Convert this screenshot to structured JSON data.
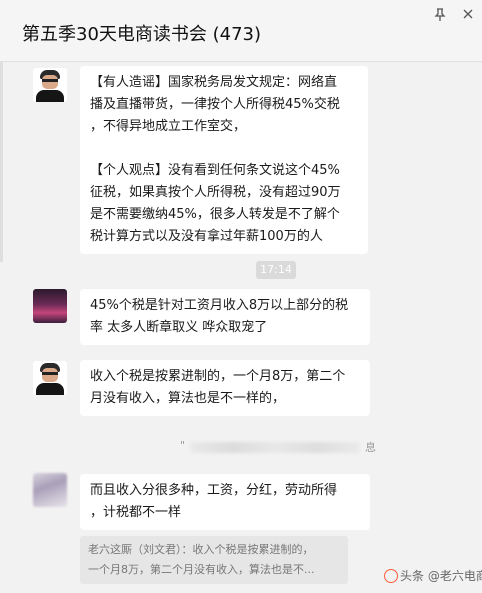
{
  "window": {
    "title": "第五季30天电商读书会 (473)",
    "pin_icon": "pin-icon",
    "close_icon": "close-icon"
  },
  "messages": [
    {
      "avatar": "man-with-glasses",
      "lines": [
        "【有人造谣】国家税务局发文规定：网络直",
        "播及直播带货，一律按个人所得税45%交税",
        "，不得异地成立工作室交，",
        "",
        "【个人观点】没有看到任何条文说这个45%",
        "征税，如果真按个人所得税，没有超过90万",
        "是不需要缴纳45%，很多人转发是不了解个",
        "税计算方式以及没有拿过年薪100万的人"
      ]
    },
    {
      "avatar": "dark-photo",
      "lines": [
        "45%个税是针对工资月收入8万以上部分的税",
        "率 太多人断章取义 哗众取宠了"
      ]
    },
    {
      "avatar": "man-with-glasses",
      "lines": [
        "收入个税是按累进制的，一个月8万，第二个",
        "月没有收入，算法也是不一样的，"
      ]
    },
    {
      "avatar": "blurred-photo",
      "lines": [
        "而且收入分很多种，工资，分红，劳动所得",
        "，计税都不一样"
      ]
    }
  ],
  "timestamp": "17:14",
  "recall_notice": {
    "prefix": "\"",
    "suffix": "息"
  },
  "quote": {
    "lines": [
      "老六这厮（刘文君）：收入个税是按累进制的，",
      "一个月8万，第二个月没有收入，算法也是不..."
    ]
  },
  "watermark": "头条 @老六电商"
}
